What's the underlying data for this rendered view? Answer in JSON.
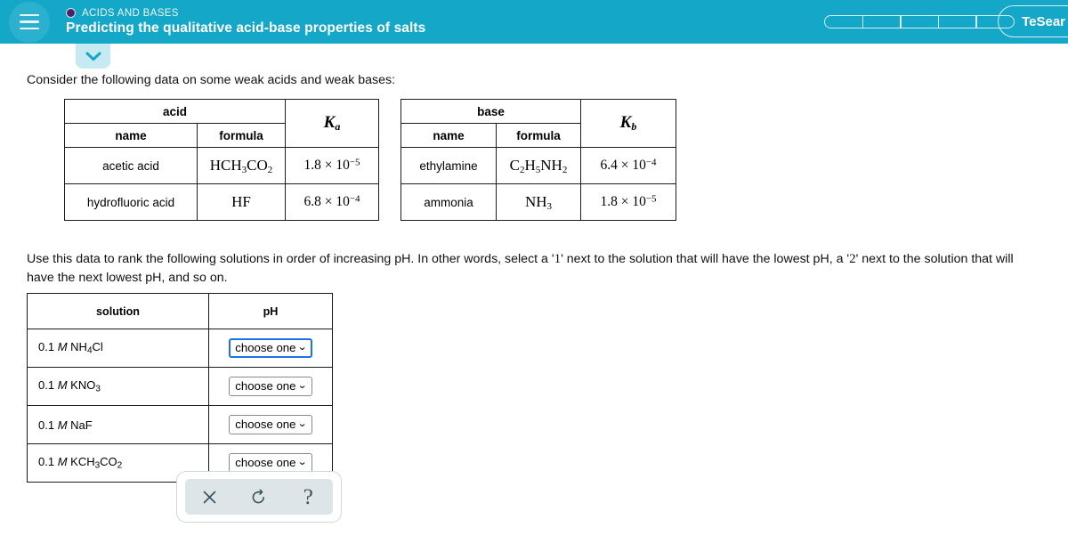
{
  "header": {
    "menu_icon": "hamburger-menu-icon",
    "topic_dot_icon": "topic-bullet-icon",
    "topic": "ACIDS AND BASES",
    "title": "Predicting the qualitative acid-base properties of salts",
    "progress_segments": 5,
    "account_button": "TeSear",
    "background_color": "#14a7c8",
    "topic_dot_color": "#4b2071"
  },
  "toggle": {
    "icon": "chevron-down-icon",
    "background_color": "#c7eaf2"
  },
  "body": {
    "intro": "Consider the following data on some weak acids and weak bases:",
    "rank_instruction_part1": "Use this data to rank the following solutions in order of increasing pH. In other words, select a '",
    "rank_num_1": "1",
    "rank_instruction_part2": "' next to the solution that will have the lowest pH, a '",
    "rank_num_2": "2",
    "rank_instruction_part3": "' next to the solution that will have the next lowest pH, and so on."
  },
  "acid_table": {
    "group_header": "acid",
    "k_header_symbol": "K",
    "k_header_sub": "a",
    "col_name": "name",
    "col_formula": "formula",
    "rows": [
      {
        "name": "acetic acid",
        "formula_parts": [
          {
            "t": "HCH"
          },
          {
            "sub": "3"
          },
          {
            "t": "CO"
          },
          {
            "sub": "2"
          }
        ],
        "k_mantissa": "1.8",
        "k_times": "× 10",
        "k_exp": "−5"
      },
      {
        "name": "hydrofluoric acid",
        "formula_parts": [
          {
            "t": "HF"
          }
        ],
        "k_mantissa": "6.8",
        "k_times": "× 10",
        "k_exp": "−4"
      }
    ]
  },
  "base_table": {
    "group_header": "base",
    "k_header_symbol": "K",
    "k_header_sub": "b",
    "col_name": "name",
    "col_formula": "formula",
    "rows": [
      {
        "name": "ethylamine",
        "formula_parts": [
          {
            "t": "C"
          },
          {
            "sub": "2"
          },
          {
            "t": "H"
          },
          {
            "sub": "5"
          },
          {
            "t": "NH"
          },
          {
            "sub": "2"
          }
        ],
        "k_mantissa": "6.4",
        "k_times": "× 10",
        "k_exp": "−4"
      },
      {
        "name": "ammonia",
        "formula_parts": [
          {
            "t": "NH"
          },
          {
            "sub": "3"
          }
        ],
        "k_mantissa": "1.8",
        "k_times": "× 10",
        "k_exp": "−5"
      }
    ]
  },
  "solution_table": {
    "col_solution": "solution",
    "col_ph": "pH",
    "rows": [
      {
        "conc": "0.1",
        "molar": "M",
        "formula_parts": [
          {
            "t": "NH"
          },
          {
            "sub": "4"
          },
          {
            "t": "Cl"
          }
        ],
        "ph_value": "choose one",
        "caret": "⌄",
        "focused": true
      },
      {
        "conc": "0.1",
        "molar": "M",
        "formula_parts": [
          {
            "t": "KNO"
          },
          {
            "sub": "3"
          }
        ],
        "ph_value": "choose one",
        "caret": "⌄",
        "focused": false
      },
      {
        "conc": "0.1",
        "molar": "M",
        "formula_parts": [
          {
            "t": "NaF"
          }
        ],
        "ph_value": "choose one",
        "caret": "⌄",
        "focused": false
      },
      {
        "conc": "0.1",
        "molar": "M",
        "formula_parts": [
          {
            "t": "KCH"
          },
          {
            "sub": "3"
          },
          {
            "t": "CO"
          },
          {
            "sub": "2"
          }
        ],
        "ph_value": "choose one",
        "caret": "⌄",
        "focused": false
      }
    ]
  },
  "toolbar": {
    "clear_icon": "close-x-icon",
    "reset_icon": "undo-refresh-icon",
    "help_icon": "question-mark-icon",
    "help_glyph": "?",
    "panel_color": "#dde5e8",
    "icon_color": "#39535f"
  }
}
